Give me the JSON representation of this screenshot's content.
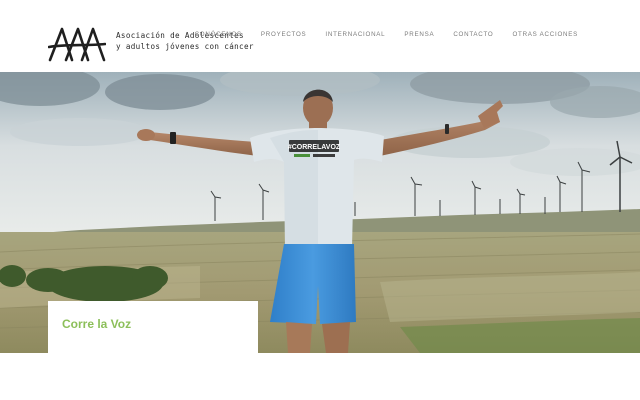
{
  "header": {
    "logo": {
      "mark": "AA",
      "line1": "Asociación de Adolescentes",
      "line2": "y adultos jóvenes con cáncer"
    },
    "nav": [
      {
        "label": "CONÓCENOS"
      },
      {
        "label": "PROYECTOS"
      },
      {
        "label": "INTERNACIONAL"
      },
      {
        "label": "PRENSA"
      },
      {
        "label": "CONTACTO"
      },
      {
        "label": "OTRAS ACCIONES"
      }
    ]
  },
  "hero": {
    "shirt_text": "#CORRELAVOZ",
    "card_title": "Corre la Voz"
  },
  "colors": {
    "accent_green": "#8cbf5a",
    "nav_text": "#7c7c7c",
    "shorts_blue": "#3f8fd6"
  }
}
